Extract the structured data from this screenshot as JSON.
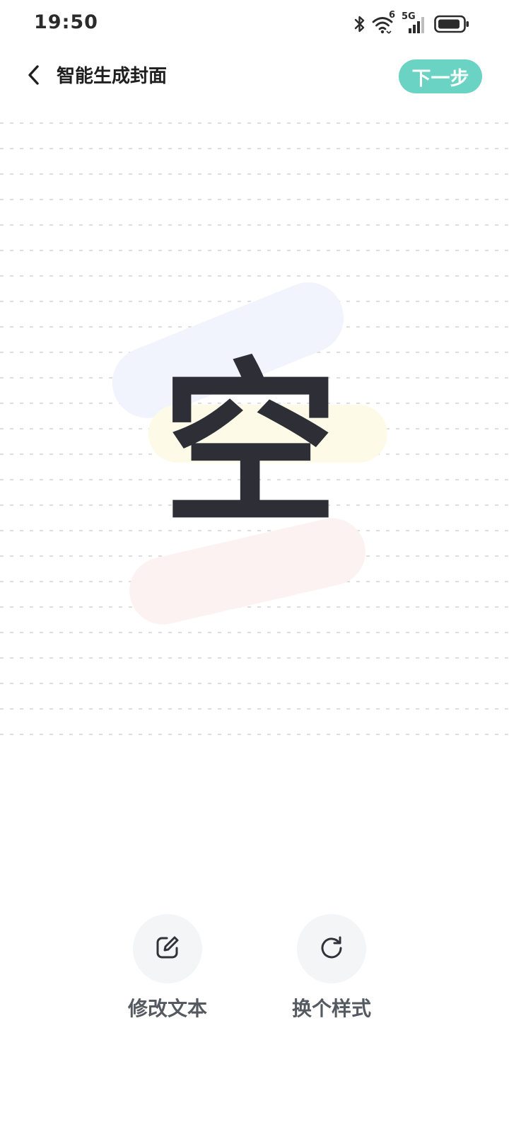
{
  "status_bar": {
    "time": "19:50",
    "wifi_badge": "6",
    "network_label": "5G",
    "icons": [
      "bluetooth-icon",
      "wifi-icon",
      "cellular-signal-icon",
      "battery-icon"
    ]
  },
  "header": {
    "title": "智能生成封面",
    "next_label": "下一步",
    "back_icon": "chevron-left-icon"
  },
  "cover": {
    "text": "空",
    "colors": {
      "text": "#2d2e36",
      "stroke_blue": "#f1f3fd",
      "stroke_yellow": "#fdfbe7",
      "stroke_pink": "#fdf2f2",
      "ruled_line": "#d4d4d4"
    }
  },
  "actions": {
    "edit_text": {
      "label": "修改文本",
      "icon": "edit-pencil-icon"
    },
    "change_style": {
      "label": "换个样式",
      "icon": "refresh-icon"
    }
  },
  "theme": {
    "accent": "#6ad3c4",
    "action_bg": "#f4f5f7",
    "action_label": "#555a61"
  }
}
